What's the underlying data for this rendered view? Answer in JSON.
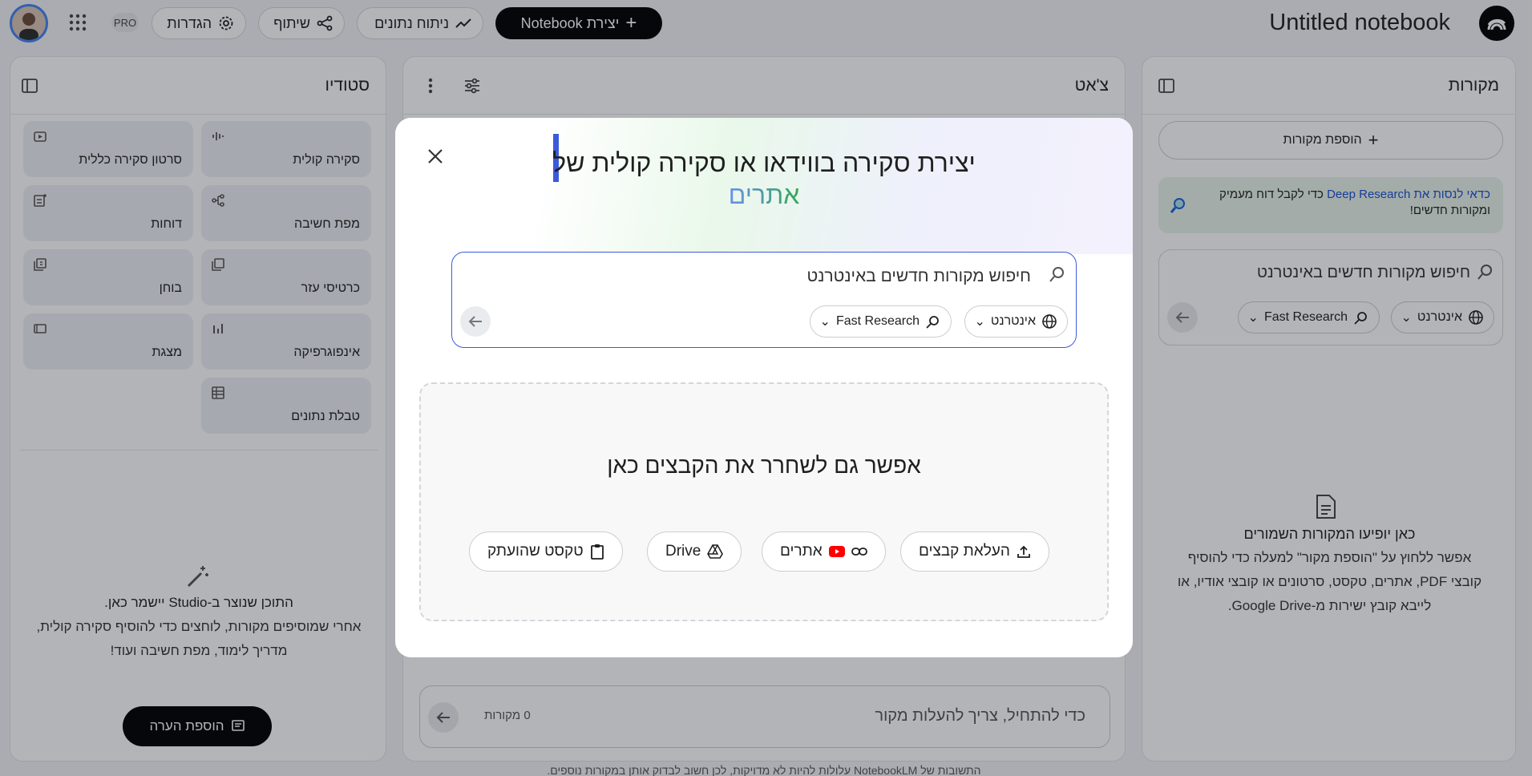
{
  "app": {
    "notebook_title": "Untitled notebook",
    "pro_badge": "PRO"
  },
  "topbar": {
    "create_label": "יצירת Notebook",
    "analytics_label": "ניתוח נתונים",
    "share_label": "שיתוף",
    "settings_label": "הגדרות"
  },
  "sources": {
    "title": "מקורות",
    "add_label": "הוספת מקורות",
    "deep_research_link": "כדאי לנסות את Deep Research",
    "deep_research_rest": " כדי לקבל דוח מעמיק ומקורות חדשים!",
    "search_placeholder": "חיפוש מקורות חדשים באינטרנט",
    "web_chip": "אינטרנט",
    "research_chip": "Fast Research",
    "empty_title": "כאן יופיעו המקורות השמורים",
    "empty_line1": "אפשר ללחוץ על \"הוספת מקור\" למעלה כדי להוסיף",
    "empty_line2": "קובצי PDF, אתרים, טקסט, סרטונים או קובצי אודיו, או",
    "empty_line3": "לייבא קובץ ישירות מ-Google Drive."
  },
  "chat": {
    "title": "צ'אט",
    "input_placeholder": "כדי להתחיל, צריך להעלות מקור",
    "source_count": "0 מקורות",
    "disclaimer": "התשובות של NotebookLM עלולות להיות לא מדויקות, לכן חשוב לבדוק אותן במקורות נוספים."
  },
  "studio": {
    "title": "סטודיו",
    "tiles": [
      {
        "label": "סקירה קולית",
        "icon": "audio-waveform-icon"
      },
      {
        "label": "סרטון סקירה כללית",
        "icon": "video-icon"
      },
      {
        "label": "מפת חשיבה",
        "icon": "mind-map-icon"
      },
      {
        "label": "דוחות",
        "icon": "reports-icon"
      },
      {
        "label": "כרטיסי עזר",
        "icon": "flashcards-icon"
      },
      {
        "label": "בוחן",
        "icon": "quiz-icon"
      },
      {
        "label": "אינפוגרפיקה",
        "icon": "bar-chart-icon"
      },
      {
        "label": "מצגת",
        "icon": "slides-icon"
      },
      {
        "label": "טבלת נתונים",
        "icon": "table-icon"
      }
    ],
    "empty_title": "התוכן שנוצר ב-Studio יישמר כאן.",
    "empty_line1": "אחרי שמוסיפים מקורות, לוחצים כדי להוסיף סקירה קולית,",
    "empty_line2": "מדריך לימוד, מפת חשיבה ועוד!",
    "add_note_label": "הוספת הערה"
  },
  "modal": {
    "title_line1": "יצירת סקירה בווידאו או סקירה קולית של",
    "title_line2": "אתרים",
    "search_placeholder": "חיפוש מקורות חדשים באינטרנט",
    "web_chip": "אינטרנט",
    "research_chip": "Fast Research",
    "drop_text": "אפשר גם לשחרר את הקבצים כאן",
    "upload_label": "העלאת קבצים",
    "websites_label": "אתרים",
    "drive_label": "Drive",
    "paste_label": "טקסט שהועתק"
  },
  "colors": {
    "accent_blue": "#3b5bdb",
    "link_blue": "#1a4fd6",
    "green": "#34a853",
    "dark_button": "#000000",
    "overlay": "rgba(20,22,30,0.32)"
  }
}
